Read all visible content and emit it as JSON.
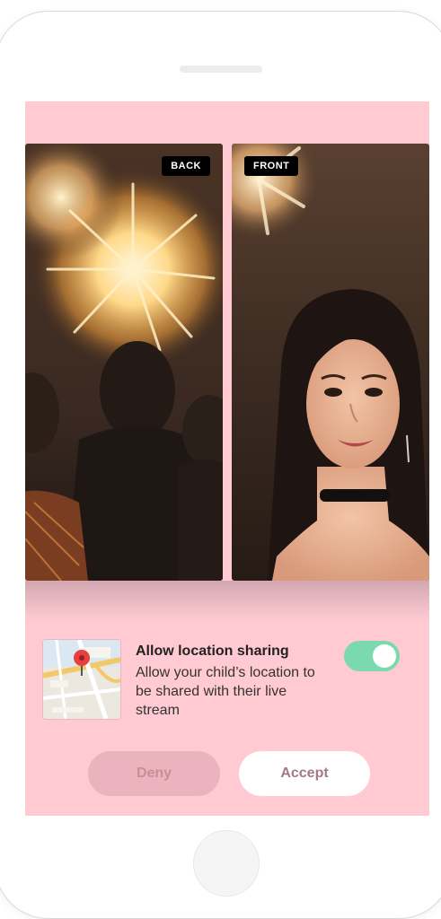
{
  "screen": {
    "back_label": "BACK",
    "front_label": "FRONT"
  },
  "consent": {
    "title": "Allow location sharing",
    "description": "Allow your child’s location to be shared with their live stream",
    "toggle_on": true,
    "deny_label": "Deny",
    "accept_label": "Accept"
  },
  "colors": {
    "screen_bg": "#ffcad2",
    "toggle_on": "#7bd9b0",
    "deny_bg": "#eab3bd",
    "accept_bg": "#ffffff"
  },
  "icons": {
    "map_thumbnail": "map-icon",
    "pin": "location-pin-icon"
  }
}
